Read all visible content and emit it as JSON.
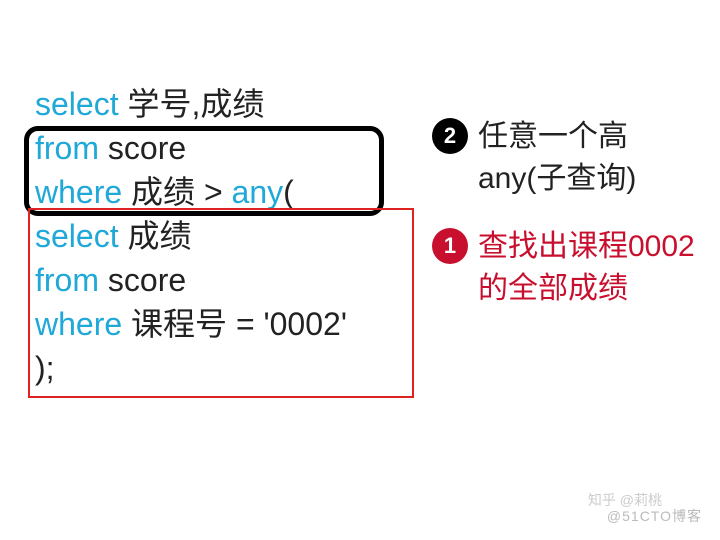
{
  "code": {
    "l1_kw": "select",
    "l1_txt": " 学号,成绩",
    "l2_kw": "from",
    "l2_txt": " score",
    "l3_kw1": "where",
    "l3_txt": " 成绩 > ",
    "l3_kw2": "any",
    "l3_tail": "(",
    "l4_kw": "select",
    "l4_txt": " 成绩",
    "l5_kw": "from",
    "l5_txt": " score",
    "l6_kw": "where",
    "l6_txt": " 课程号 = '0002'",
    "l7": ");"
  },
  "annotations": {
    "two_line1": "任意一个高",
    "two_line2": "any(子查询)",
    "one_line1": "查找出课程0002",
    "one_line2": "的全部成绩",
    "badge_black": "2",
    "badge_red": "1"
  },
  "watermark": {
    "top": "知乎 @莉桃",
    "bottom": "@51CTO博客"
  }
}
